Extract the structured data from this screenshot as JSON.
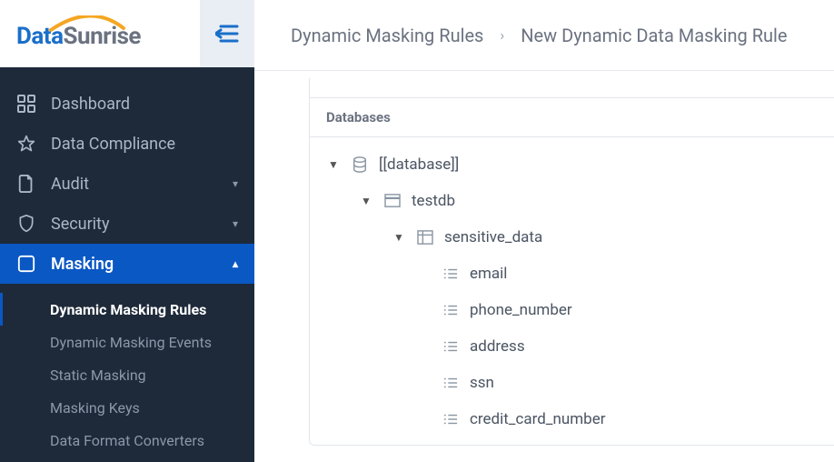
{
  "brand": {
    "part1": "Data",
    "part2": "Sunrise"
  },
  "nav": {
    "items": [
      {
        "label": "Dashboard"
      },
      {
        "label": "Data Compliance"
      },
      {
        "label": "Audit"
      },
      {
        "label": "Security"
      },
      {
        "label": "Masking"
      }
    ]
  },
  "subnav": {
    "items": [
      {
        "label": "Dynamic Masking Rules"
      },
      {
        "label": "Dynamic Masking Events"
      },
      {
        "label": "Static Masking"
      },
      {
        "label": "Masking Keys"
      },
      {
        "label": "Data Format Converters"
      }
    ]
  },
  "breadcrumb": {
    "a": "Dynamic Masking Rules",
    "b": "New Dynamic Data Masking Rule"
  },
  "panel": {
    "title": "Databases"
  },
  "tree": {
    "db": "[[database]]",
    "schema": "testdb",
    "table": "sensitive_data",
    "cols": [
      "email",
      "phone_number",
      "address",
      "ssn",
      "credit_card_number"
    ]
  }
}
